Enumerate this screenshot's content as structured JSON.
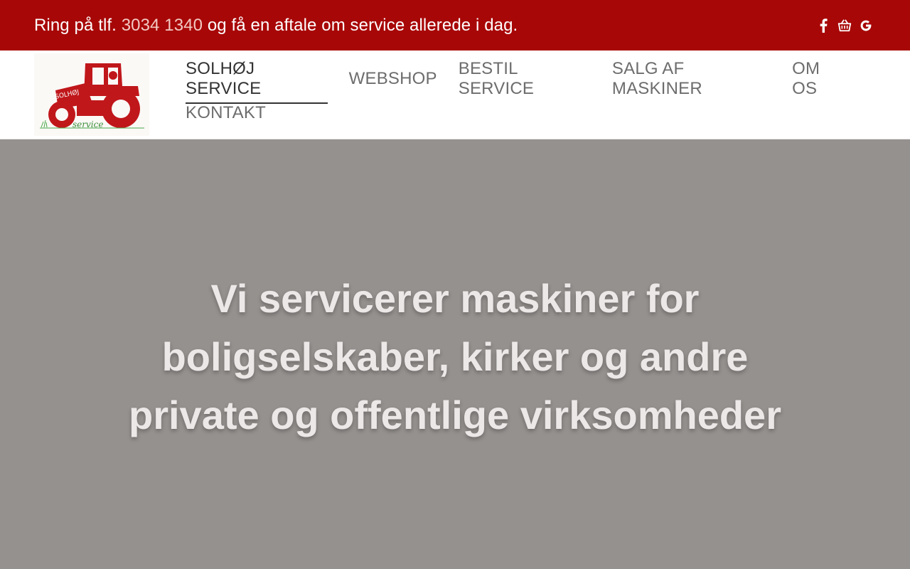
{
  "topbar": {
    "text_before": "Ring på tlf.",
    "phone": "3034 1340",
    "text_after": "og få en aftale om service allerede i dag.",
    "icons": [
      "facebook-icon",
      "shop-basket-icon",
      "google-icon"
    ],
    "background_color": "#a80707"
  },
  "logo": {
    "brand_text": "SOLHØJ",
    "sub_text": "service",
    "color": "#c0171b"
  },
  "nav": {
    "items": [
      {
        "label": "SOLHØJ SERVICE",
        "active": true
      },
      {
        "label": "WEBSHOP"
      },
      {
        "label": "BESTIL SERVICE"
      },
      {
        "label": "SALG AF MASKINER"
      },
      {
        "label": "OM OS"
      },
      {
        "label": "KONTAKT"
      }
    ]
  },
  "hero": {
    "title": "Vi servicerer maskiner for boligselskaber, kirker og andre private og offentlige virksomheder"
  }
}
